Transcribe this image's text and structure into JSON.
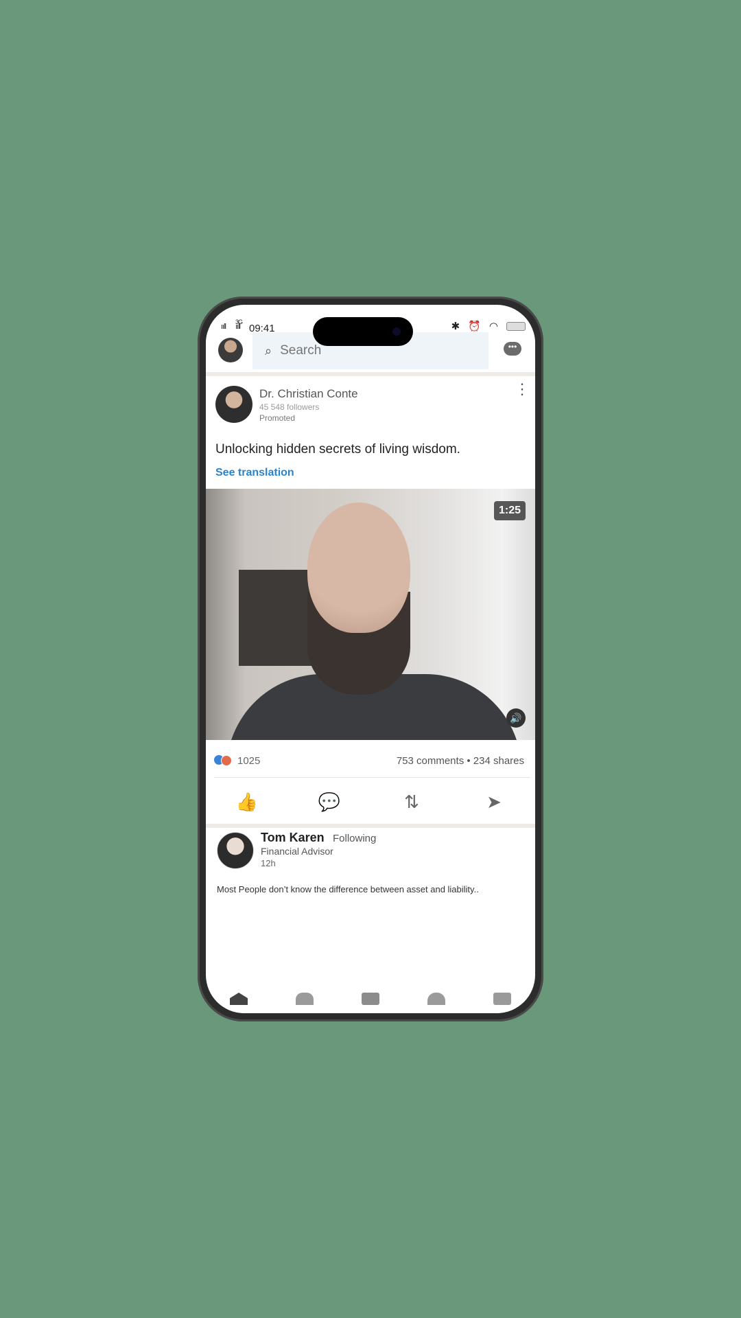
{
  "status": {
    "time": "09:41",
    "signal_left": "ııll",
    "network": "3G",
    "signal_right": "ııll"
  },
  "search": {
    "placeholder": "Search"
  },
  "post": {
    "author_name": "Dr. Christian Conte",
    "followers": "45 548 followers",
    "promoted": "Promoted",
    "text": "Unlocking hidden secrets of living wisdom.",
    "see_translation": "See translation",
    "video_duration": "1:25",
    "likes": "1025",
    "comments_shares": "753 comments  •  234 shares"
  },
  "post2": {
    "author_name": "Tom Karen",
    "following": "Following",
    "title": "Financial  Advisor",
    "time": "12h",
    "text": "Most People don’t know the difference between asset and liability.."
  },
  "icons": {
    "search": "search-icon",
    "messages": "chat-icon",
    "more": "more-vertical-icon",
    "sound": "volume-icon",
    "like": "thumb-up-icon",
    "comment": "comment-icon",
    "repost": "repost-icon",
    "send": "send-icon",
    "home": "home-icon",
    "network": "people-icon",
    "post": "add-icon",
    "notifications": "bell-icon",
    "jobs": "briefcase-icon"
  },
  "colors": {
    "background": "#6a987b",
    "link": "#2a84cc",
    "separator": "#eeebe6"
  }
}
